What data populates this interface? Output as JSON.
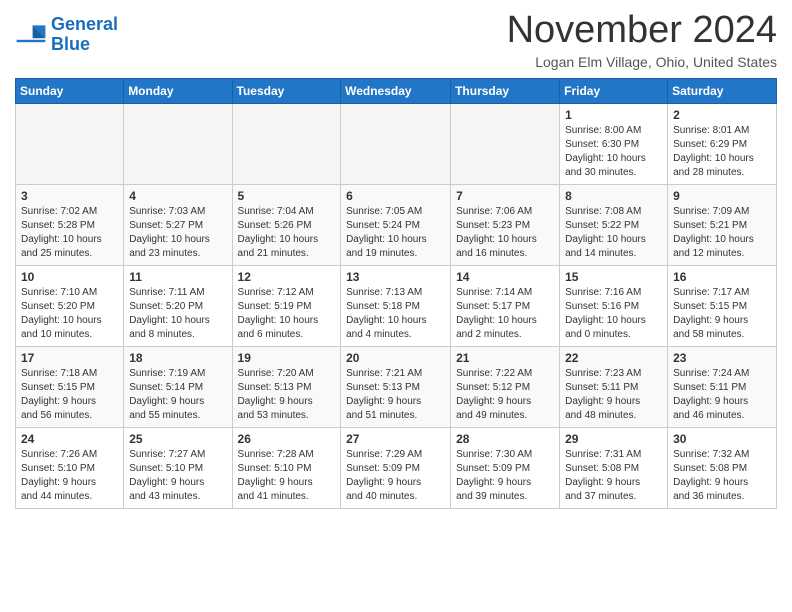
{
  "header": {
    "logo_line1": "General",
    "logo_line2": "Blue",
    "month": "November 2024",
    "location": "Logan Elm Village, Ohio, United States"
  },
  "weekdays": [
    "Sunday",
    "Monday",
    "Tuesday",
    "Wednesday",
    "Thursday",
    "Friday",
    "Saturday"
  ],
  "weeks": [
    [
      {
        "day": "",
        "info": ""
      },
      {
        "day": "",
        "info": ""
      },
      {
        "day": "",
        "info": ""
      },
      {
        "day": "",
        "info": ""
      },
      {
        "day": "",
        "info": ""
      },
      {
        "day": "1",
        "info": "Sunrise: 8:00 AM\nSunset: 6:30 PM\nDaylight: 10 hours\nand 30 minutes."
      },
      {
        "day": "2",
        "info": "Sunrise: 8:01 AM\nSunset: 6:29 PM\nDaylight: 10 hours\nand 28 minutes."
      }
    ],
    [
      {
        "day": "3",
        "info": "Sunrise: 7:02 AM\nSunset: 5:28 PM\nDaylight: 10 hours\nand 25 minutes."
      },
      {
        "day": "4",
        "info": "Sunrise: 7:03 AM\nSunset: 5:27 PM\nDaylight: 10 hours\nand 23 minutes."
      },
      {
        "day": "5",
        "info": "Sunrise: 7:04 AM\nSunset: 5:26 PM\nDaylight: 10 hours\nand 21 minutes."
      },
      {
        "day": "6",
        "info": "Sunrise: 7:05 AM\nSunset: 5:24 PM\nDaylight: 10 hours\nand 19 minutes."
      },
      {
        "day": "7",
        "info": "Sunrise: 7:06 AM\nSunset: 5:23 PM\nDaylight: 10 hours\nand 16 minutes."
      },
      {
        "day": "8",
        "info": "Sunrise: 7:08 AM\nSunset: 5:22 PM\nDaylight: 10 hours\nand 14 minutes."
      },
      {
        "day": "9",
        "info": "Sunrise: 7:09 AM\nSunset: 5:21 PM\nDaylight: 10 hours\nand 12 minutes."
      }
    ],
    [
      {
        "day": "10",
        "info": "Sunrise: 7:10 AM\nSunset: 5:20 PM\nDaylight: 10 hours\nand 10 minutes."
      },
      {
        "day": "11",
        "info": "Sunrise: 7:11 AM\nSunset: 5:20 PM\nDaylight: 10 hours\nand 8 minutes."
      },
      {
        "day": "12",
        "info": "Sunrise: 7:12 AM\nSunset: 5:19 PM\nDaylight: 10 hours\nand 6 minutes."
      },
      {
        "day": "13",
        "info": "Sunrise: 7:13 AM\nSunset: 5:18 PM\nDaylight: 10 hours\nand 4 minutes."
      },
      {
        "day": "14",
        "info": "Sunrise: 7:14 AM\nSunset: 5:17 PM\nDaylight: 10 hours\nand 2 minutes."
      },
      {
        "day": "15",
        "info": "Sunrise: 7:16 AM\nSunset: 5:16 PM\nDaylight: 10 hours\nand 0 minutes."
      },
      {
        "day": "16",
        "info": "Sunrise: 7:17 AM\nSunset: 5:15 PM\nDaylight: 9 hours\nand 58 minutes."
      }
    ],
    [
      {
        "day": "17",
        "info": "Sunrise: 7:18 AM\nSunset: 5:15 PM\nDaylight: 9 hours\nand 56 minutes."
      },
      {
        "day": "18",
        "info": "Sunrise: 7:19 AM\nSunset: 5:14 PM\nDaylight: 9 hours\nand 55 minutes."
      },
      {
        "day": "19",
        "info": "Sunrise: 7:20 AM\nSunset: 5:13 PM\nDaylight: 9 hours\nand 53 minutes."
      },
      {
        "day": "20",
        "info": "Sunrise: 7:21 AM\nSunset: 5:13 PM\nDaylight: 9 hours\nand 51 minutes."
      },
      {
        "day": "21",
        "info": "Sunrise: 7:22 AM\nSunset: 5:12 PM\nDaylight: 9 hours\nand 49 minutes."
      },
      {
        "day": "22",
        "info": "Sunrise: 7:23 AM\nSunset: 5:11 PM\nDaylight: 9 hours\nand 48 minutes."
      },
      {
        "day": "23",
        "info": "Sunrise: 7:24 AM\nSunset: 5:11 PM\nDaylight: 9 hours\nand 46 minutes."
      }
    ],
    [
      {
        "day": "24",
        "info": "Sunrise: 7:26 AM\nSunset: 5:10 PM\nDaylight: 9 hours\nand 44 minutes."
      },
      {
        "day": "25",
        "info": "Sunrise: 7:27 AM\nSunset: 5:10 PM\nDaylight: 9 hours\nand 43 minutes."
      },
      {
        "day": "26",
        "info": "Sunrise: 7:28 AM\nSunset: 5:10 PM\nDaylight: 9 hours\nand 41 minutes."
      },
      {
        "day": "27",
        "info": "Sunrise: 7:29 AM\nSunset: 5:09 PM\nDaylight: 9 hours\nand 40 minutes."
      },
      {
        "day": "28",
        "info": "Sunrise: 7:30 AM\nSunset: 5:09 PM\nDaylight: 9 hours\nand 39 minutes."
      },
      {
        "day": "29",
        "info": "Sunrise: 7:31 AM\nSunset: 5:08 PM\nDaylight: 9 hours\nand 37 minutes."
      },
      {
        "day": "30",
        "info": "Sunrise: 7:32 AM\nSunset: 5:08 PM\nDaylight: 9 hours\nand 36 minutes."
      }
    ]
  ]
}
